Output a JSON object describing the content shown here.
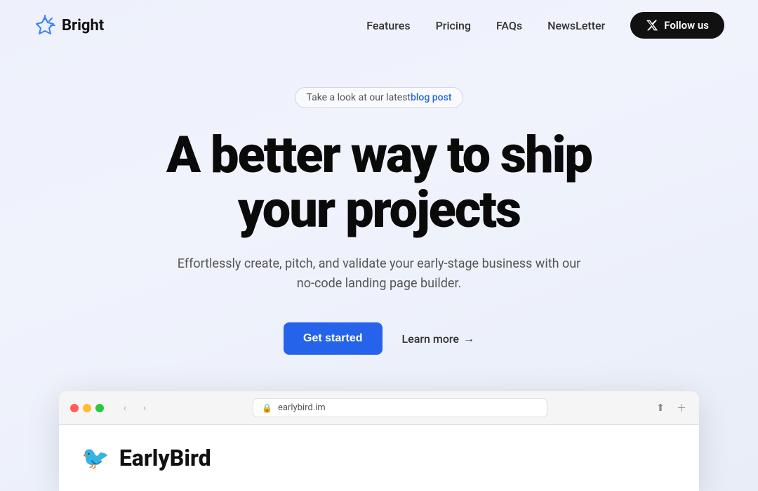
{
  "nav": {
    "logo_text": "Bright",
    "links": [
      {
        "label": "Features",
        "id": "features"
      },
      {
        "label": "Pricing",
        "id": "pricing"
      },
      {
        "label": "FAQs",
        "id": "faqs"
      },
      {
        "label": "NewsLetter",
        "id": "newsletter"
      }
    ],
    "follow_btn": "Follow us"
  },
  "hero": {
    "badge_text": "Take a look at our latest ",
    "badge_link_text": "blog post",
    "title_line1": "A better way to ship",
    "title_line2": "your projects",
    "subtitle": "Effortlessly create, pitch, and validate your early-stage business with our no-code landing page builder.",
    "cta_primary": "Get started",
    "cta_secondary": "Learn more",
    "cta_arrow": "→"
  },
  "browser": {
    "url": "earlybird.im",
    "earlybird_emoji": "🐦",
    "earlybird_title": "EarlyBird"
  },
  "colors": {
    "accent_blue": "#2563eb",
    "dark": "#111111"
  }
}
